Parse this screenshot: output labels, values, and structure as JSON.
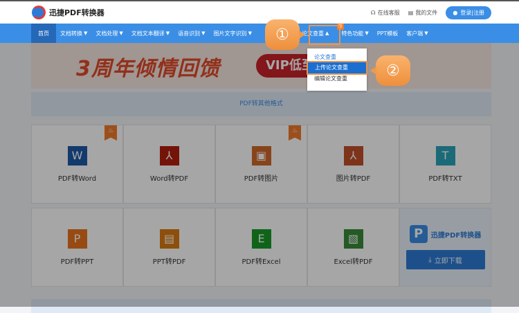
{
  "header": {
    "brand": "迅捷PDF转换器",
    "service": "在线客服",
    "files": "我的文件",
    "login": "登录|注册"
  },
  "nav": {
    "items": [
      "首页",
      "文档转换",
      "文档处理",
      "文档文本翻译",
      "语音识别",
      "图片文字识别",
      "论文查重",
      "特色功能",
      "PPT模板",
      "客户端"
    ],
    "new_badge": "新"
  },
  "dropdown": {
    "title": "论文查重",
    "items": [
      "上传论文查重",
      "编辑论文查重"
    ]
  },
  "callouts": [
    "①",
    "②"
  ],
  "banner": {
    "title": "3周年倾情回馈",
    "vip": "VIP低至"
  },
  "section": {
    "title": "PDF转其他格式"
  },
  "tools": [
    {
      "label": "PDF转Word",
      "glyph": "W",
      "color": "#1e5aa8",
      "hot": true
    },
    {
      "label": "Word转PDF",
      "glyph": "⅄",
      "color": "#b3200e",
      "hot": false
    },
    {
      "label": "PDF转图片",
      "glyph": "▣",
      "color": "#d0692a",
      "hot": true
    },
    {
      "label": "图片转PDF",
      "glyph": "⅄",
      "color": "#c1502a",
      "hot": false
    },
    {
      "label": "PDF转TXT",
      "glyph": "T",
      "color": "#2aa3b8",
      "hot": false
    },
    {
      "label": "PDF转PPT",
      "glyph": "P",
      "color": "#e8741c",
      "hot": false
    },
    {
      "label": "PPT转PDF",
      "glyph": "▤",
      "color": "#d97a12",
      "hot": false
    },
    {
      "label": "PDF转Excel",
      "glyph": "E",
      "color": "#1a9a28",
      "hot": false
    },
    {
      "label": "Excel转PDF",
      "glyph": "▧",
      "color": "#3a8a3a",
      "hot": false
    }
  ],
  "download": {
    "brand": "迅捷PDF转换器",
    "button": "立即下载"
  }
}
